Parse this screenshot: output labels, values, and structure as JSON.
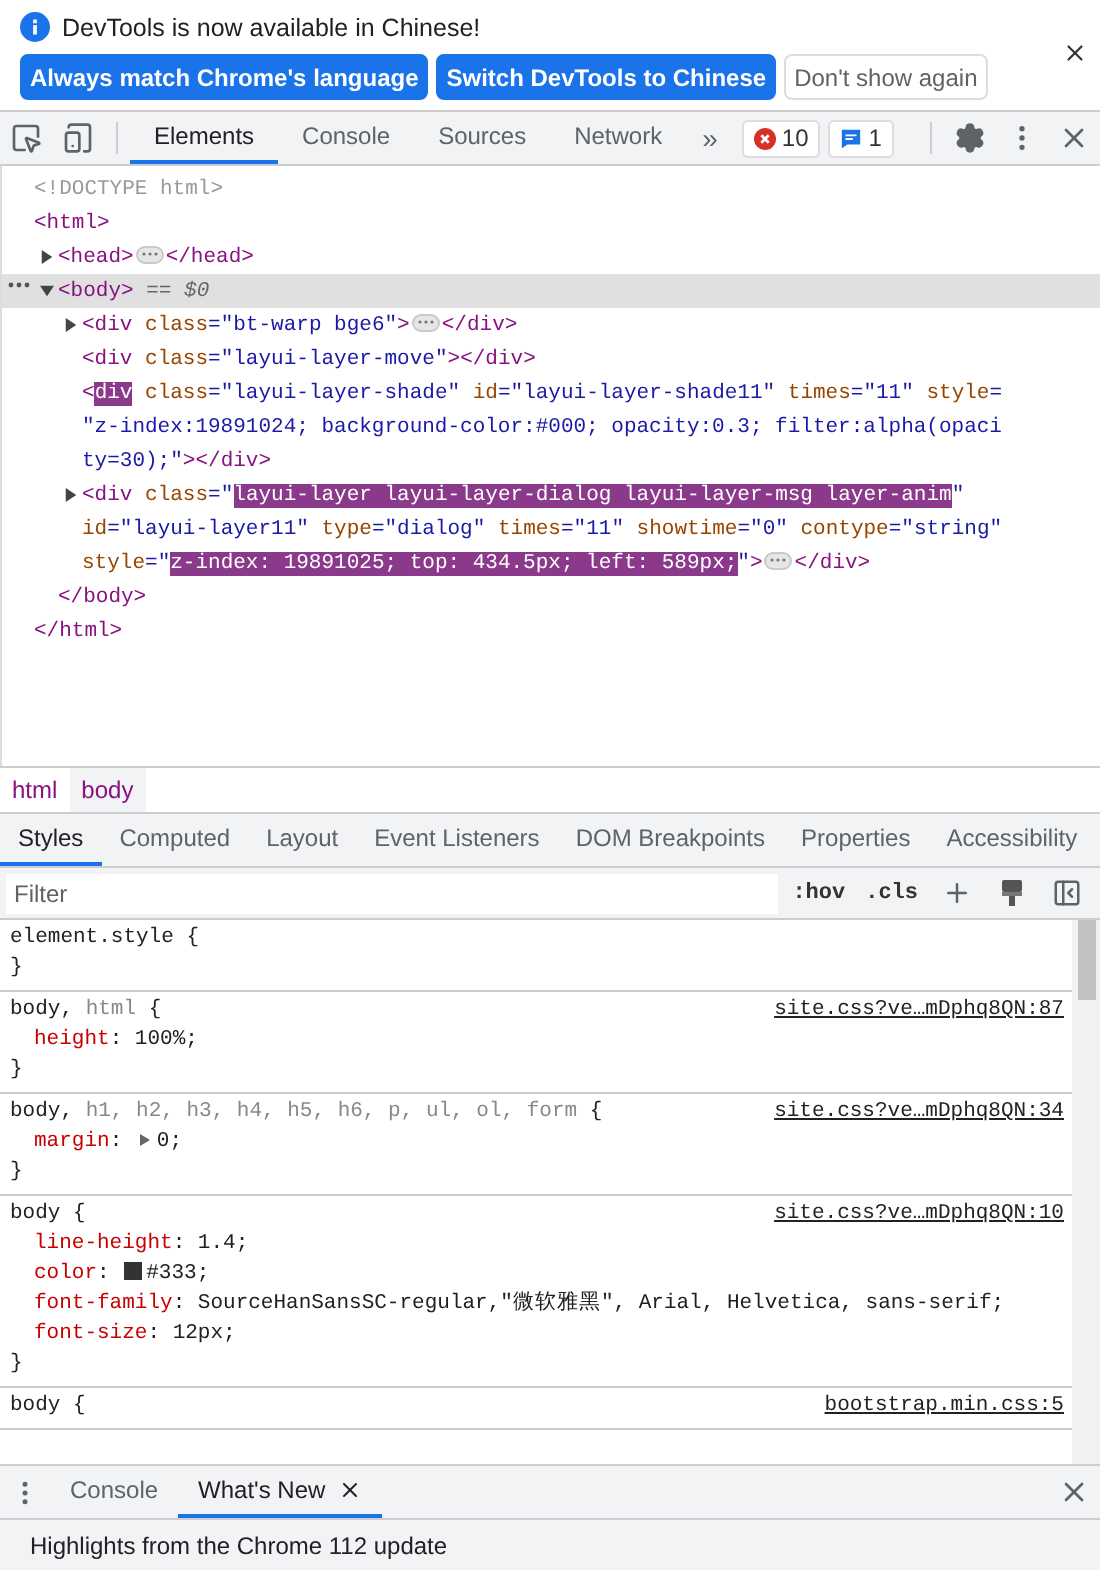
{
  "notice": {
    "message": "DevTools is now available in Chinese!",
    "buttons": [
      {
        "label": "Always match Chrome's language",
        "kind": "primary"
      },
      {
        "label": "Switch DevTools to Chinese",
        "kind": "primary"
      },
      {
        "label": "Don't show again",
        "kind": "secondary"
      }
    ]
  },
  "toolbar": {
    "tabs": [
      {
        "label": "Elements",
        "selected": true
      },
      {
        "label": "Console",
        "selected": false
      },
      {
        "label": "Sources",
        "selected": false
      },
      {
        "label": "Network",
        "selected": false
      }
    ],
    "more": "»",
    "errors": "10",
    "messages": "1"
  },
  "dom_tree": [
    {
      "lines": [
        [
          {
            "kind": "doctype",
            "text": "<!DOCTYPE html>"
          }
        ]
      ],
      "expandable": false,
      "selected": false
    },
    {
      "lines": [
        [
          {
            "kind": "tag",
            "text": "<html>"
          }
        ]
      ],
      "expandable": false,
      "selected": false,
      "children": [
        {
          "lines": [
            [
              {
                "kind": "tag",
                "text": "<head>"
              },
              {
                "kind": "dots"
              },
              {
                "kind": "tag",
                "text": "</head>"
              }
            ]
          ],
          "expandable": true,
          "expanded": false,
          "selected": false
        },
        {
          "lines": [
            [
              {
                "kind": "tag",
                "text": "<body>"
              },
              {
                "kind": "muted",
                "text": " == $0"
              }
            ]
          ],
          "expandable": true,
          "expanded": true,
          "selected": true,
          "children": [
            {
              "lines": [
                [
                  {
                    "kind": "tag",
                    "text": "<div"
                  },
                  {
                    "kind": "attr",
                    "text": " class"
                  },
                  {
                    "kind": "value",
                    "text": "=\"bt-warp bge6\""
                  },
                  {
                    "kind": "tag",
                    "text": ">"
                  },
                  {
                    "kind": "dots"
                  },
                  {
                    "kind": "tag",
                    "text": "</div>"
                  }
                ]
              ],
              "expandable": true,
              "expanded": false,
              "selected": false
            },
            {
              "lines": [
                [
                  {
                    "kind": "tag",
                    "text": "<div"
                  },
                  {
                    "kind": "attr",
                    "text": " class"
                  },
                  {
                    "kind": "value",
                    "text": "=\"layui-layer-move\""
                  },
                  {
                    "kind": "tag",
                    "text": "></div>"
                  }
                ]
              ],
              "expandable": false,
              "selected": false
            },
            {
              "lines": [
                [
                  {
                    "kind": "tag",
                    "text": "<"
                  },
                  {
                    "kind": "taghl",
                    "text": "div"
                  },
                  {
                    "kind": "attr",
                    "text": " class"
                  },
                  {
                    "kind": "value",
                    "text": "=\"layui-layer-shade\""
                  },
                  {
                    "kind": "attr",
                    "text": " id"
                  },
                  {
                    "kind": "value",
                    "text": "=\"layui-layer-shade11\""
                  },
                  {
                    "kind": "attr",
                    "text": " times"
                  },
                  {
                    "kind": "value",
                    "text": "=\"11\""
                  },
                  {
                    "kind": "attr",
                    "text": " style"
                  },
                  {
                    "kind": "value",
                    "text": "="
                  }
                ],
                [
                  {
                    "kind": "value",
                    "text": "\"z-index:19891024; background-color:#000; opacity:0.3; filter:alpha(opaci"
                  }
                ],
                [
                  {
                    "kind": "value",
                    "text": "ty=30);\""
                  },
                  {
                    "kind": "tag",
                    "text": "></div>"
                  }
                ]
              ],
              "expandable": false,
              "selected": false
            },
            {
              "lines": [
                [
                  {
                    "kind": "tag",
                    "text": "<div"
                  },
                  {
                    "kind": "attr",
                    "text": " class"
                  },
                  {
                    "kind": "value",
                    "text": "=\""
                  },
                  {
                    "kind": "hl",
                    "text": "layui-layer layui-layer-dialog layui-layer-msg layer-anim"
                  },
                  {
                    "kind": "value",
                    "text": "\""
                  }
                ],
                [
                  {
                    "kind": "attr",
                    "text": "id"
                  },
                  {
                    "kind": "value",
                    "text": "=\"layui-layer11\""
                  },
                  {
                    "kind": "attr",
                    "text": " type"
                  },
                  {
                    "kind": "value",
                    "text": "=\"dialog\""
                  },
                  {
                    "kind": "attr",
                    "text": " times"
                  },
                  {
                    "kind": "value",
                    "text": "=\"11\""
                  },
                  {
                    "kind": "attr",
                    "text": " showtime"
                  },
                  {
                    "kind": "value",
                    "text": "=\"0\""
                  },
                  {
                    "kind": "attr",
                    "text": " contype"
                  },
                  {
                    "kind": "value",
                    "text": "=\"string\""
                  }
                ],
                [
                  {
                    "kind": "attr",
                    "text": "style"
                  },
                  {
                    "kind": "value",
                    "text": "=\""
                  },
                  {
                    "kind": "hl",
                    "text": "z-index: 19891025; top: 434.5px; left: 589px;"
                  },
                  {
                    "kind": "value",
                    "text": "\""
                  },
                  {
                    "kind": "tag",
                    "text": ">"
                  },
                  {
                    "kind": "dots"
                  },
                  {
                    "kind": "tag",
                    "text": "</div>"
                  }
                ]
              ],
              "expandable": true,
              "expanded": false,
              "selected": false
            }
          ],
          "closing": [
            {
              "kind": "tag",
              "text": "</body>"
            }
          ]
        }
      ],
      "closing": [
        {
          "kind": "tag",
          "text": "</html>"
        }
      ]
    }
  ],
  "breadcrumbs": [
    {
      "label": "html",
      "selected": false
    },
    {
      "label": "body",
      "selected": true
    }
  ],
  "styles_tabs": [
    {
      "label": "Styles",
      "selected": true
    },
    {
      "label": "Computed",
      "selected": false
    },
    {
      "label": "Layout",
      "selected": false
    },
    {
      "label": "Event Listeners",
      "selected": false
    },
    {
      "label": "DOM Breakpoints",
      "selected": false
    },
    {
      "label": "Properties",
      "selected": false
    },
    {
      "label": "Accessibility",
      "selected": false
    }
  ],
  "filter": {
    "placeholder": "Filter",
    "hov": ":hov",
    "cls": ".cls"
  },
  "rules": [
    {
      "selectors": [
        {
          "text": "element.style",
          "matched": true
        }
      ],
      "brace": " {",
      "close": "}"
    },
    {
      "selectors": [
        {
          "text": "body, ",
          "matched": true
        },
        {
          "text": "html",
          "matched": false
        }
      ],
      "brace": " {",
      "source": "site.css?ve…mDphq8QN:87",
      "declarations": [
        {
          "property": "height",
          "colon": ": ",
          "value": "100%;",
          "expandable": false
        }
      ],
      "close": "}"
    },
    {
      "selectors": [
        {
          "text": "body, ",
          "matched": true
        },
        {
          "text": "h1, h2, h3, h4, h5, h6, p, ul, ol, form",
          "matched": false
        }
      ],
      "brace": " {",
      "source": "site.css?ve…mDphq8QN:34",
      "declarations": [
        {
          "property": "margin",
          "colon": ": ",
          "value": "0;",
          "expandable": true
        }
      ],
      "close": "}"
    },
    {
      "selectors": [
        {
          "text": "body",
          "matched": true
        }
      ],
      "brace": " {",
      "source": "site.css?ve…mDphq8QN:10",
      "declarations": [
        {
          "property": "line-height",
          "colon": ": ",
          "value": "1.4;",
          "expandable": false
        },
        {
          "property": "color",
          "colon": ": ",
          "value": "#333;",
          "expandable": false,
          "color": "#333333"
        },
        {
          "property": "font-family",
          "colon": ": ",
          "value": "SourceHanSansSC-regular,\"微软雅黑\", Arial, Helvetica, sans-serif;",
          "expandable": false
        },
        {
          "property": "font-size",
          "colon": ": ",
          "value": "12px;",
          "expandable": false
        }
      ],
      "close": "}"
    },
    {
      "selectors": [
        {
          "text": "body",
          "matched": true
        }
      ],
      "brace": " {",
      "source": "bootstrap.min.css:5"
    }
  ],
  "drawer": {
    "tabs": [
      {
        "label": "Console",
        "selected": false,
        "closable": false
      },
      {
        "label": "What's New",
        "selected": true,
        "closable": true
      }
    ],
    "content": "Highlights from the Chrome 112 update"
  }
}
